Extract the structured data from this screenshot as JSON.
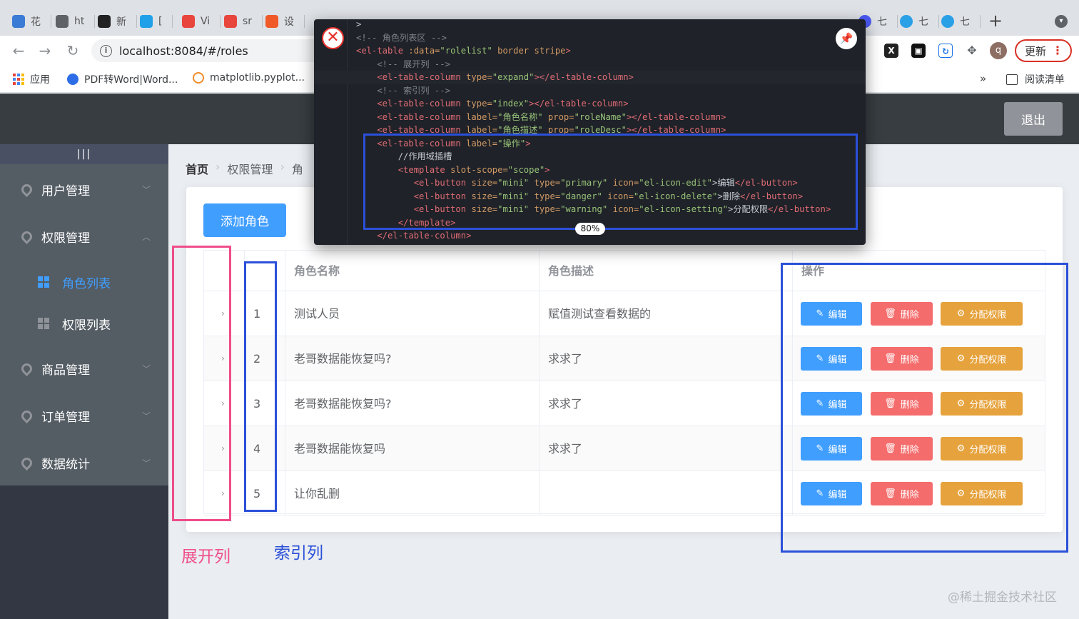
{
  "browser": {
    "tabs": [
      {
        "label": "花",
        "icon": "yuque-icon",
        "color": "#3a7bd5"
      },
      {
        "label": "ht",
        "icon": "globe-icon",
        "color": "#5f6368"
      },
      {
        "label": "新",
        "icon": "infinity-icon",
        "color": "#222222"
      },
      {
        "label": "[",
        "icon": "bilibili-icon",
        "color": "#20a0e8"
      },
      {
        "label": "Vi",
        "icon": "vue-icon",
        "color": "#e8453c"
      },
      {
        "label": "sr",
        "icon": "search-engine-icon",
        "color": "#e8453c"
      },
      {
        "label": "设",
        "icon": "csdn-icon",
        "color": "#f05a28"
      }
    ],
    "right_tabs": [
      {
        "label": "七",
        "color": "#4b59f5"
      },
      {
        "label": "七",
        "color": "#2aa0e6"
      },
      {
        "label": "七",
        "color": "#2aa0e6"
      }
    ],
    "new_tab": "+",
    "url": "localhost:8084/#/roles",
    "update_label": "更新",
    "avatar_letter": "q",
    "bookmarks": [
      {
        "label": "应用"
      },
      {
        "label": "PDF转Word|Word..."
      },
      {
        "label": "matplotlib.pyplot..."
      }
    ],
    "more": "»",
    "reading_list": "阅读清单"
  },
  "header": {
    "logout_label": "退出"
  },
  "sidebar": {
    "toggle": "|||",
    "items": [
      {
        "label": "用户管理",
        "expanded": false
      },
      {
        "label": "权限管理",
        "expanded": true
      },
      {
        "label": "商品管理",
        "expanded": false
      },
      {
        "label": "订单管理",
        "expanded": false
      },
      {
        "label": "数据统计",
        "expanded": false
      }
    ],
    "sub_items": [
      {
        "label": "角色列表",
        "active": true
      },
      {
        "label": "权限列表",
        "active": false
      }
    ]
  },
  "breadcrumb": [
    "首页",
    "权限管理",
    "角"
  ],
  "add_role_label": "添加角色",
  "table": {
    "headers": [
      "角色名称",
      "角色描述",
      "操作"
    ],
    "rows": [
      {
        "index": "1",
        "name": "测试人员",
        "desc": "赋值测试查看数据的"
      },
      {
        "index": "2",
        "name": "老哥数据能恢复吗?",
        "desc": "求求了"
      },
      {
        "index": "3",
        "name": "老哥数据能恢复吗?",
        "desc": "求求了"
      },
      {
        "index": "4",
        "name": "老哥数据能恢复吗",
        "desc": "求求了"
      },
      {
        "index": "5",
        "name": "让你乱删",
        "desc": ""
      }
    ],
    "actions": {
      "edit": "编辑",
      "delete": "删除",
      "assign": "分配权限"
    }
  },
  "annotations": {
    "expand_column": "展开列",
    "index_column": "索引列"
  },
  "watermark": "@稀土掘金技术社区",
  "code_popup": {
    "zoom": "80%",
    "lines": [
      [
        [
          "c-txt",
          ">"
        ]
      ],
      [
        [
          "c-com",
          "<!-- 角色列表区 -->"
        ]
      ],
      [
        [
          "c-tag",
          "<el-table "
        ],
        [
          "c-attr",
          ":data="
        ],
        [
          "c-str",
          "\"rolelist\""
        ],
        [
          "c-attr",
          " border stripe"
        ],
        [
          "c-tag",
          ">"
        ]
      ],
      [
        [
          "c-com",
          "    <!-- 展开列 -->"
        ]
      ],
      [
        [
          "c-tag",
          "    <el-table-column "
        ],
        [
          "c-attr",
          "type="
        ],
        [
          "c-str",
          "\"expand\""
        ],
        [
          "c-tag",
          "></el-table-column>"
        ]
      ],
      [
        [
          "c-com",
          "    <!-- 索引列 -->"
        ]
      ],
      [
        [
          "c-tag",
          "    <el-table-column "
        ],
        [
          "c-attr",
          "type="
        ],
        [
          "c-str",
          "\"index\""
        ],
        [
          "c-tag",
          "></el-table-column>"
        ]
      ],
      [
        [
          "c-tag",
          "    <el-table-column "
        ],
        [
          "c-attr",
          "label="
        ],
        [
          "c-str",
          "\"角色名称\""
        ],
        [
          "c-attr",
          " prop="
        ],
        [
          "c-str",
          "\"roleName\""
        ],
        [
          "c-tag",
          "></el-table-column>"
        ]
      ],
      [
        [
          "c-tag",
          "    <el-table-column "
        ],
        [
          "c-attr",
          "label="
        ],
        [
          "c-str",
          "\"角色描述\""
        ],
        [
          "c-attr",
          " prop="
        ],
        [
          "c-str",
          "\"roleDesc\""
        ],
        [
          "c-tag",
          "></el-table-column>"
        ]
      ],
      [
        [
          "c-tag",
          "    <el-table-column "
        ],
        [
          "c-attr",
          "label="
        ],
        [
          "c-str",
          "\"操作\""
        ],
        [
          "c-tag",
          ">"
        ]
      ],
      [
        [
          "c-txt",
          "        //作用域插槽"
        ]
      ],
      [
        [
          "c-tag",
          "        <template "
        ],
        [
          "c-attr",
          "slot-scope="
        ],
        [
          "c-str",
          "\"scope\""
        ],
        [
          "c-tag",
          ">"
        ]
      ],
      [
        [
          "c-tag",
          "           <el-button "
        ],
        [
          "c-attr",
          "size="
        ],
        [
          "c-str",
          "\"mini\""
        ],
        [
          "c-attr",
          " type="
        ],
        [
          "c-str",
          "\"primary\""
        ],
        [
          "c-attr",
          " icon="
        ],
        [
          "c-str",
          "\"el-icon-edit\""
        ],
        [
          "c-txt",
          ">编辑"
        ],
        [
          "c-tag",
          "</el-button>"
        ]
      ],
      [
        [
          "c-tag",
          "           <el-button "
        ],
        [
          "c-attr",
          "size="
        ],
        [
          "c-str",
          "\"mini\""
        ],
        [
          "c-attr",
          " type="
        ],
        [
          "c-str",
          "\"danger\""
        ],
        [
          "c-attr",
          " icon="
        ],
        [
          "c-str",
          "\"el-icon-delete\""
        ],
        [
          "c-txt",
          ">删除"
        ],
        [
          "c-tag",
          "</el-button>"
        ]
      ],
      [
        [
          "c-tag",
          "           <el-button "
        ],
        [
          "c-attr",
          "size="
        ],
        [
          "c-str",
          "\"mini\""
        ],
        [
          "c-attr",
          " type="
        ],
        [
          "c-str",
          "\"warning\""
        ],
        [
          "c-attr",
          " icon="
        ],
        [
          "c-str",
          "\"el-icon-setting\""
        ],
        [
          "c-txt",
          ">分配权限"
        ],
        [
          "c-tag",
          "</el-button>"
        ]
      ],
      [
        [
          "c-tag",
          "        </template>"
        ]
      ],
      [
        [
          "c-tag",
          "    </el-table-column>"
        ]
      ]
    ]
  }
}
